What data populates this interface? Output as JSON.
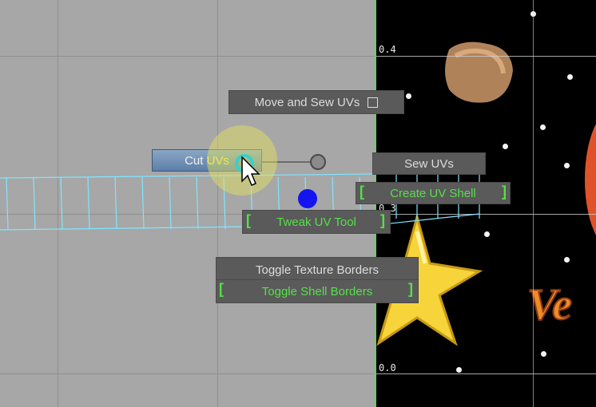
{
  "uv_editor": {
    "axis_labels": {
      "top": "0.4",
      "middle": "0.3",
      "bottom": "0.0"
    },
    "marking_menu": {
      "move_and_sew": "Move and Sew UVs",
      "cut_uvs_prefix": "Cut",
      "cut_uvs_highlight": "UVs",
      "sew_uvs": "Sew UVs",
      "create_uv_shell": "Create UV Shell",
      "tweak_uv_tool": "Tweak UV Tool",
      "toggle_texture_borders": "Toggle Texture Borders",
      "toggle_shell_borders": "Toggle Shell Borders"
    },
    "texture_text": "Ve",
    "colors": {
      "menu_bg": "#5a5a5a",
      "active_green": "#55e04a",
      "cut_button_blue": "#6f8fb6",
      "uv_edge_cyan": "#7fe6ff",
      "border_green": "#5ed65e"
    },
    "icons": [
      "checkbox-icon",
      "cursor-arrow-icon",
      "cursor-highlight-icon"
    ]
  }
}
